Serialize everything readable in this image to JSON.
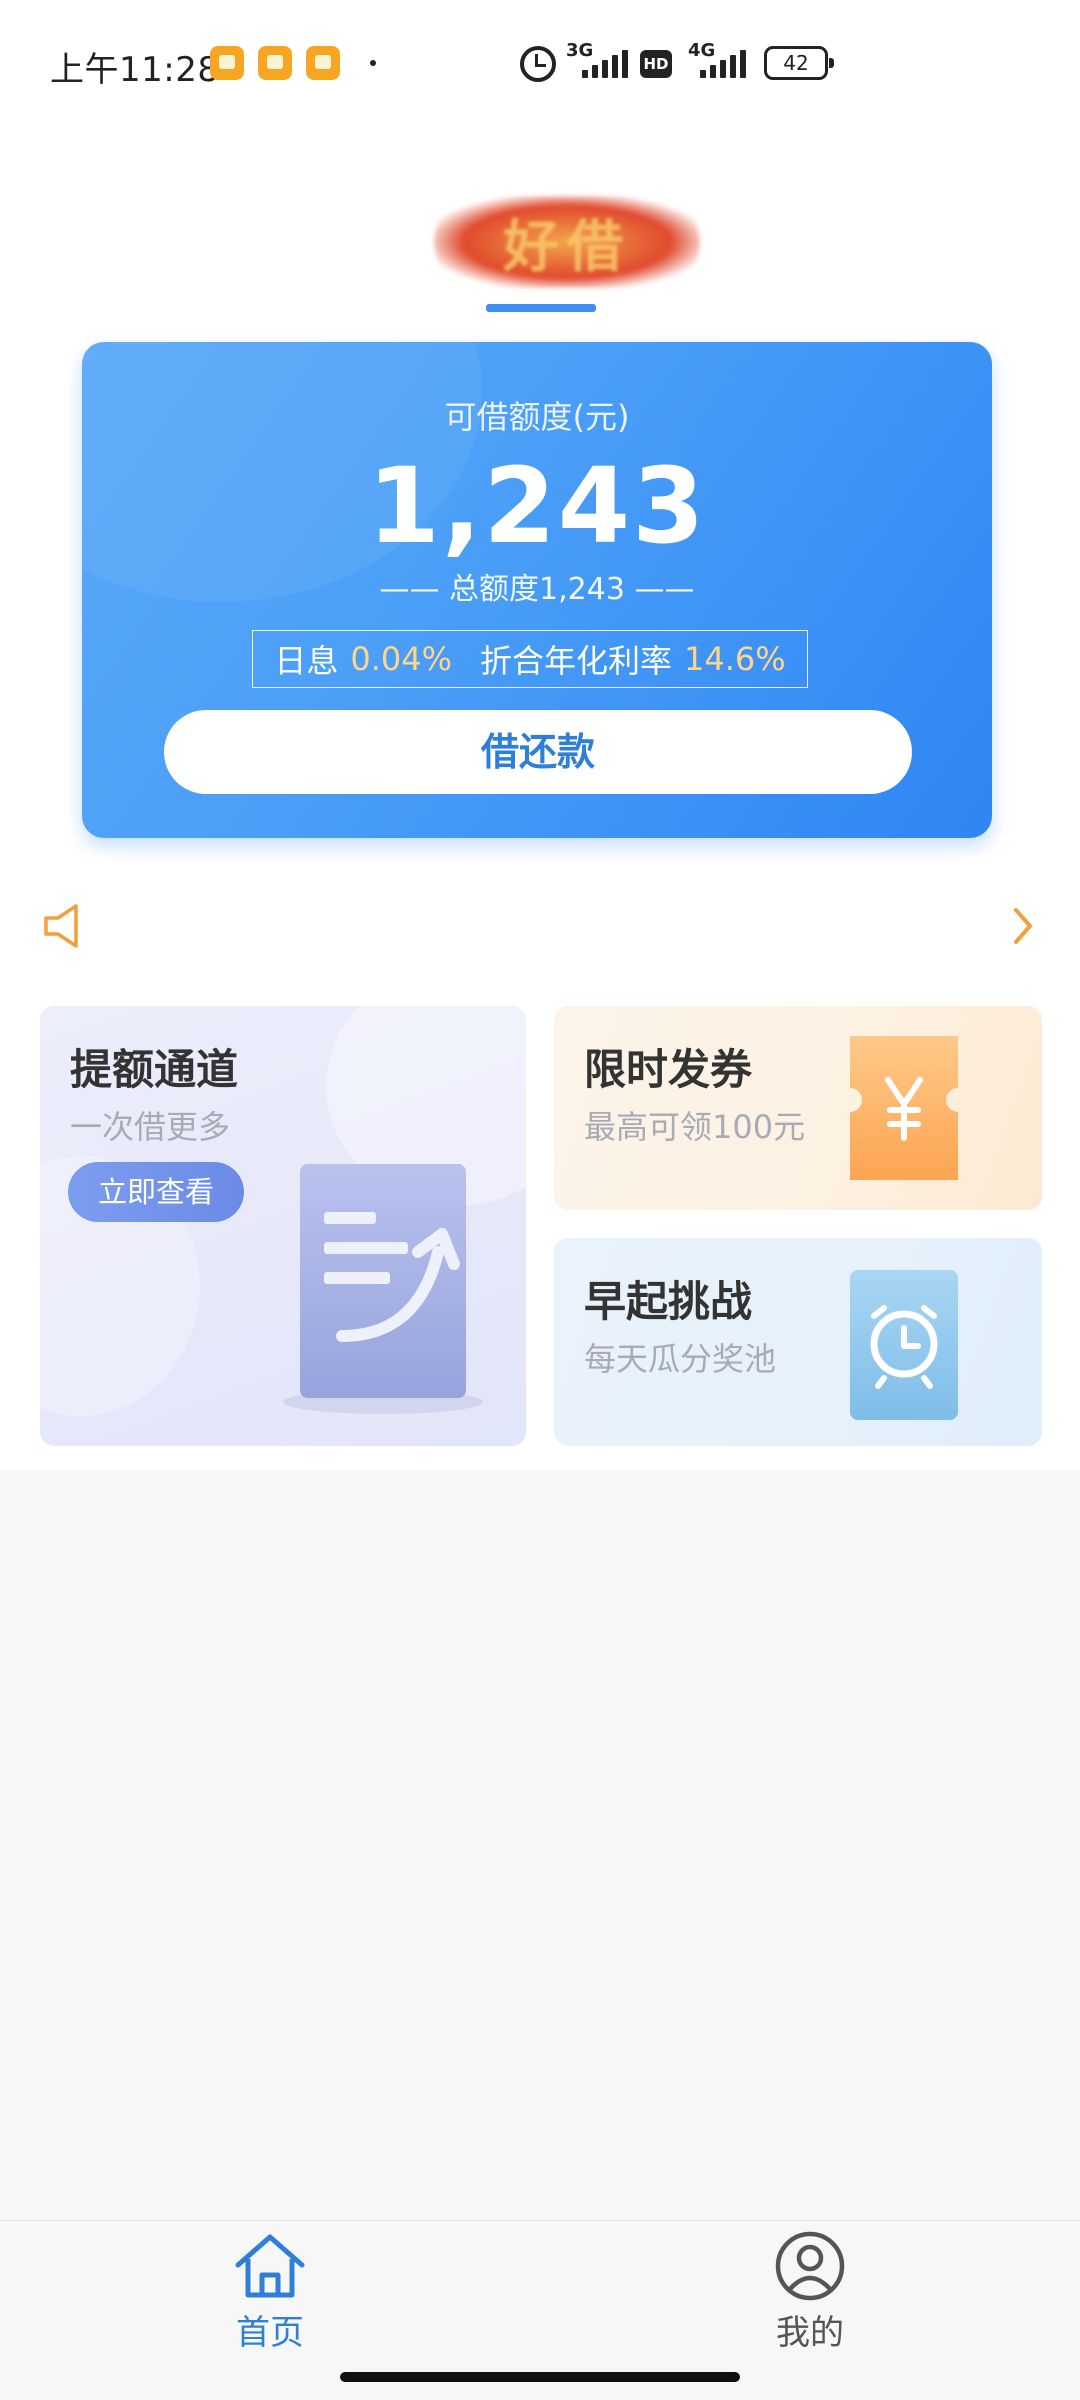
{
  "status_bar": {
    "time": "上午11:28",
    "net1": "3G",
    "net2": "4G",
    "hd": "HD",
    "battery": "42"
  },
  "header": {
    "logo_text": "好借",
    "logo_colors": [
      "#e14a2e",
      "#f2a64a"
    ]
  },
  "credit_card": {
    "label": "可借额度(元)",
    "amount": "1,243",
    "total_text": "—— 总额度1,243 ——",
    "daily_label": "日息",
    "daily_value": "0.04%",
    "annual_label": "折合年化利率",
    "annual_value": "14.6%",
    "button_label": "借还款",
    "accent": "#2f86f3"
  },
  "notice": {
    "icon": "speaker-icon",
    "chevron": "chevron-right-icon",
    "accent": "#f0a03c"
  },
  "features": {
    "limit": {
      "title": "提额通道",
      "subtitle": "一次借更多",
      "button_label": "立即查看",
      "icon": "document-arrow-icon"
    },
    "coupon": {
      "title": "限时发券",
      "subtitle": "最高可领100元",
      "icon": "yuan-ticket-icon"
    },
    "early": {
      "title": "早起挑战",
      "subtitle": "每天瓜分奖池",
      "icon": "alarm-clock-icon"
    }
  },
  "bottom_nav": {
    "items": [
      {
        "label": "首页",
        "icon": "home-icon",
        "active": true
      },
      {
        "label": "我的",
        "icon": "user-icon",
        "active": false
      }
    ]
  }
}
